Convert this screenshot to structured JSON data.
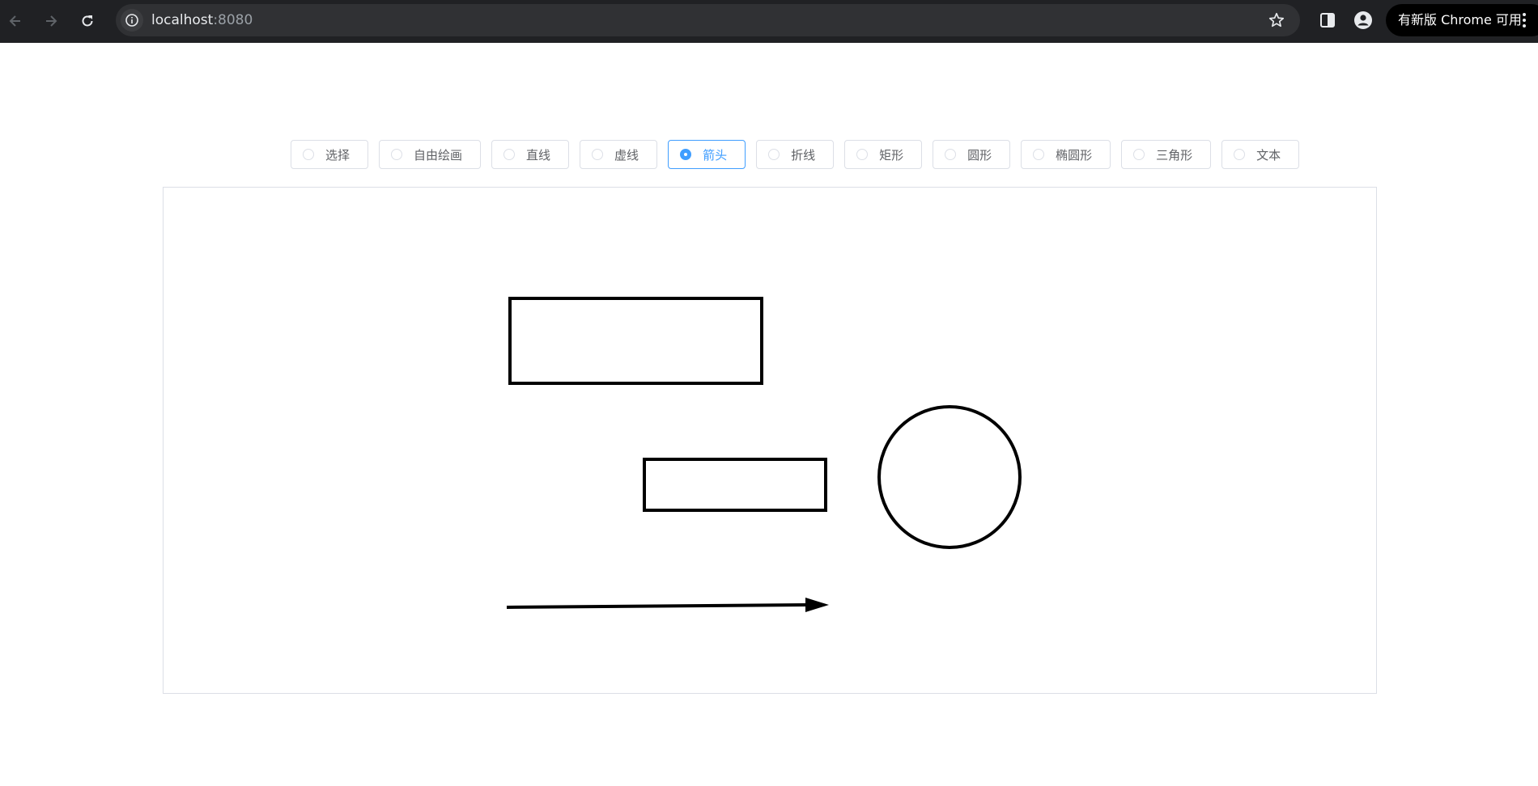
{
  "browser": {
    "url_host": "localhost",
    "url_port": ":8080",
    "update_button_label": "有新版 Chrome 可用",
    "icons": {
      "back": "back-arrow-icon",
      "forward": "forward-arrow-icon",
      "reload": "reload-icon",
      "site_info": "info-icon",
      "bookmark": "star-icon",
      "side_panel": "side-panel-icon",
      "profile": "profile-icon",
      "menu": "kebab-menu-icon"
    }
  },
  "toolbar": {
    "selected": "箭头",
    "tools": [
      {
        "label": "选择"
      },
      {
        "label": "自由绘画"
      },
      {
        "label": "直线"
      },
      {
        "label": "虚线"
      },
      {
        "label": "箭头"
      },
      {
        "label": "折线"
      },
      {
        "label": "矩形"
      },
      {
        "label": "圆形"
      },
      {
        "label": "椭圆形"
      },
      {
        "label": "三角形"
      },
      {
        "label": "文本"
      }
    ]
  },
  "canvas": {
    "shapes": [
      "rectangle",
      "rectangle",
      "circle",
      "arrow"
    ],
    "stroke_color": "#000000",
    "accent_color": "#409eff"
  }
}
